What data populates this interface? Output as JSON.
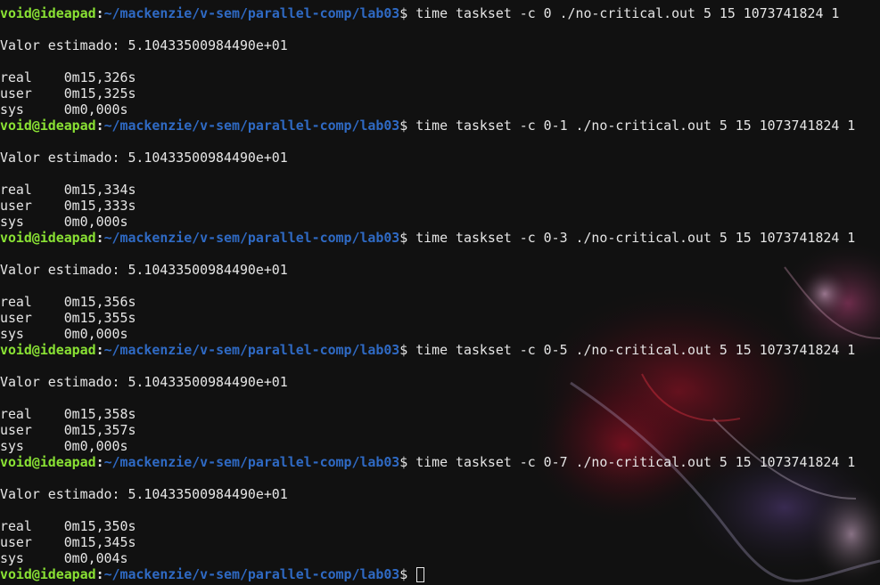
{
  "prompt": {
    "user_host": "void@ideapad",
    "colon": ":",
    "path": "~/mackenzie/v-sem/parallel-comp/lab03",
    "dollar": "$ "
  },
  "runs": [
    {
      "command": "time taskset -c 0 ./no-critical.out 5 15 1073741824 1",
      "output": "Valor estimado: 5.10433500984490e+01",
      "real": "real    0m15,326s",
      "user": "user    0m15,325s",
      "sys": "sys     0m0,000s"
    },
    {
      "command": "time taskset -c 0-1 ./no-critical.out 5 15 1073741824 1",
      "output": "Valor estimado: 5.10433500984490e+01",
      "real": "real    0m15,334s",
      "user": "user    0m15,333s",
      "sys": "sys     0m0,000s"
    },
    {
      "command": "time taskset -c 0-3 ./no-critical.out 5 15 1073741824 1",
      "output": "Valor estimado: 5.10433500984490e+01",
      "real": "real    0m15,356s",
      "user": "user    0m15,355s",
      "sys": "sys     0m0,000s"
    },
    {
      "command": "time taskset -c 0-5 ./no-critical.out 5 15 1073741824 1",
      "output": "Valor estimado: 5.10433500984490e+01",
      "real": "real    0m15,358s",
      "user": "user    0m15,357s",
      "sys": "sys     0m0,000s"
    },
    {
      "command": "time taskset -c 0-7 ./no-critical.out 5 15 1073741824 1",
      "output": "Valor estimado: 5.10433500984490e+01",
      "real": "real    0m15,350s",
      "user": "user    0m15,345s",
      "sys": "sys     0m0,004s"
    }
  ],
  "colors": {
    "background": "#111111",
    "text": "#e6e6e6",
    "prompt_user": "#8ae234",
    "prompt_path": "#2f6ac4"
  },
  "icons": {
    "cursor": "block-cursor-icon"
  }
}
